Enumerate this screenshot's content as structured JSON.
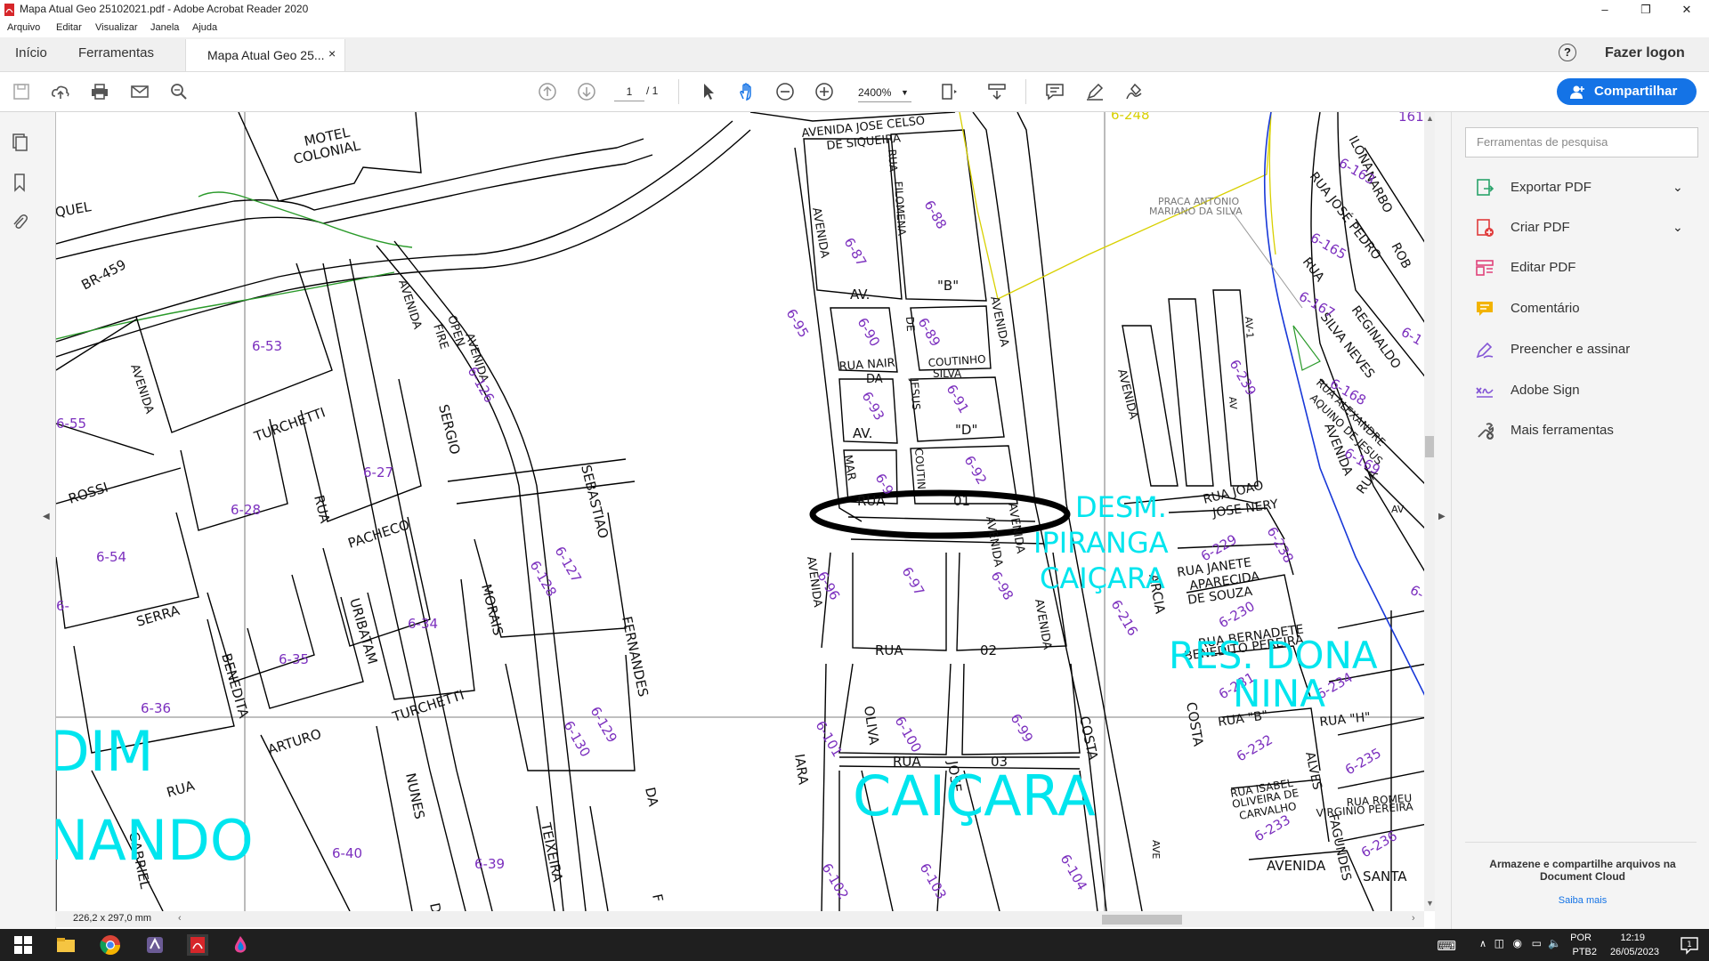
{
  "window": {
    "title": "Mapa Atual Geo 25102021.pdf - Adobe Acrobat Reader 2020",
    "minimize": "–",
    "maximize": "❐",
    "close": "✕"
  },
  "menu": [
    "Arquivo",
    "Editar",
    "Visualizar",
    "Janela",
    "Ajuda"
  ],
  "tabs": {
    "home": "Início",
    "tools": "Ferramentas",
    "document": "Mapa Atual Geo 25...",
    "close": "×",
    "help": "?",
    "login": "Fazer logon"
  },
  "toolbar": {
    "page_current": "1",
    "page_total": "/ 1",
    "zoom": "2400%",
    "share_label": "Compartilhar"
  },
  "right_panel": {
    "search_placeholder": "Ferramentas de pesquisa",
    "tools": [
      {
        "label": "Exportar PDF",
        "icon": "export-pdf-icon",
        "color": "#2aa36b",
        "expand": true
      },
      {
        "label": "Criar PDF",
        "icon": "create-pdf-icon",
        "color": "#e03c3c",
        "expand": true
      },
      {
        "label": "Editar PDF",
        "icon": "edit-pdf-icon",
        "color": "#e0427a",
        "expand": false
      },
      {
        "label": "Comentário",
        "icon": "comment-icon",
        "color": "#f2b300",
        "expand": false
      },
      {
        "label": "Preencher e assinar",
        "icon": "fill-sign-icon",
        "color": "#8456d6",
        "expand": false
      },
      {
        "label": "Adobe Sign",
        "icon": "adobe-sign-icon",
        "color": "#8456d6",
        "expand": false
      },
      {
        "label": "Mais ferramentas",
        "icon": "more-tools-icon",
        "color": "#555555",
        "expand": false
      }
    ],
    "cloud_text": "Armazene e compartilhe arquivos na Document Cloud",
    "cloud_link": "Saiba mais"
  },
  "status": {
    "page_size": "226,2 x 297,0 mm"
  },
  "map": {
    "streets": {
      "motel": "MOTEL",
      "colonial": "COLONIAL",
      "quel": "QUEL",
      "br459": "BR-459",
      "av_jose_celso": "AVENIDA JOSE CELSO",
      "de_siqueira": "DE SIQUEIRA",
      "rua_filomena": "RUA",
      "filomena": "FILOMENA",
      "avenida": "AVENIDA",
      "av_b": "AV.",
      "b": "\"B\"",
      "de": "DE",
      "rua_nair": "RUA NAIR",
      "da": "DA",
      "coutinho": "COUTINHO",
      "silva": "SILVA",
      "jesus": "JESUS",
      "av_d": "AV.",
      "d": "\"D\"",
      "mar": "MAR",
      "coutin": "COUTIN",
      "rua01": "RUA",
      "n01": "01",
      "rua02": "RUA",
      "n02": "02",
      "rua03": "RUA",
      "n03": "03",
      "open": "OPEN",
      "fire": "FIRE",
      "turchetti": "TURCHETTI",
      "turchetti2": "TURCHETTI",
      "sergio": "SERGIO",
      "rossi": "ROSSI",
      "rua": "RUA",
      "pacheco": "PACHECO",
      "morais": "MORAIS",
      "sebastiao": "SEBASTIAO",
      "fernandes": "FERNANDES",
      "serra": "SERRA",
      "uribatam": "URIBATAM",
      "benedita": "BENEDITA",
      "arturo": "ARTURO",
      "nunes": "NUNES",
      "teixeira": "TEIXEIRA",
      "gabriel": "GABRIEL",
      "rua_sw": "RUA",
      "iara": "IARA",
      "oliva": "OLIVA",
      "jose": "JOSE",
      "costa": "COSTA",
      "costa2": "COSTA",
      "da2": "DA",
      "f": "F",
      "d2": "D",
      "praca1": "PRACA ANTONIO",
      "praca2": "MARIANO DA SILVA",
      "ilona": "ILONA",
      "narbo": "NARBO",
      "rua_jose_pedro": "RUA JOSÉ PEDRO",
      "rob": "ROB",
      "rua_e": "RUA",
      "silva_neves": "SILVA NEVES",
      "reginaldo": "REGINALDO",
      "rua_alexandre": "RUA ALEXANDRE",
      "aquino": "AQUINO DE JESUS",
      "av1": "AV-1",
      "av": "AV",
      "rua_joao": "RUA JOAO",
      "jose_nery": "JOSE NERY",
      "rua_janete": "RUA JANETE",
      "aparecida": "APARECIDA",
      "de_souza": "DE SOUZA",
      "rua_bernadete": "RUA BERNADETE",
      "benedito_pereira": "BENEDITO PEREIRA",
      "rua_b": "RUA \"B\"",
      "rua_h": "RUA \"H\"",
      "rua_isabel": "RUA ISABEL",
      "oliveira": "OLIVEIRA DE",
      "carvalho": "CARVALHO",
      "alves": "ALVES",
      "fagundes": "FAGUNDES",
      "rua_romeu": "RUA ROMEU",
      "virginio": "VIRGINIO PEREIRA",
      "avenida_s": "AVENIDA",
      "santa": "SANTA",
      "ave": "AVE",
      "arcia": "ARCIA",
      "rua_east": "RUA",
      "avenida_e": "AVENIDA"
    },
    "lots": [
      "6-248",
      "6-87",
      "6-88",
      "6-95",
      "6-90",
      "6-89",
      "6-93",
      "6-91",
      "6-9",
      "6-92",
      "6-53",
      "6-126",
      "6-55",
      "6-27",
      "6-28",
      "6-54",
      "6-127",
      "6-128",
      "6-96",
      "6-97",
      "6-98",
      "6-216",
      "6-34",
      "6-35",
      "6-36",
      "6-129",
      "6-130",
      "6-101",
      "6-100",
      "6-99",
      "6-40",
      "6-39",
      "6-102",
      "6-103",
      "6-104",
      "161",
      "6-163",
      "6-165",
      "6-167",
      "6-168",
      "6-169",
      "6-239",
      "6-229",
      "6-238",
      "6-230",
      "6-231",
      "6-234",
      "6-232",
      "6-235",
      "6-233",
      "6-236",
      "6-1",
      "6-",
      "6-"
    ],
    "labels": {
      "ipiranga1": "DESM.",
      "ipiranga2": "IPIRANGA",
      "ipiranga3": "CAIÇARA",
      "dona1": "RES. DONA",
      "dona2": "NINA",
      "caicara": "CAIÇARA",
      "jardim": "DIM",
      "nando": "NANDO"
    }
  },
  "taskbar": {
    "lang1": "POR",
    "lang2": "PTB2",
    "time": "12:19",
    "date": "26/05/2023"
  }
}
